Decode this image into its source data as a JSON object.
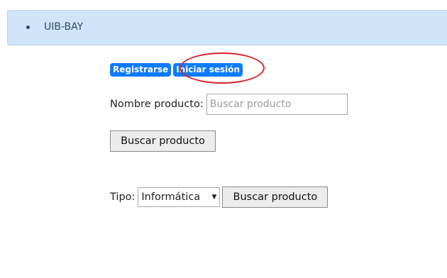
{
  "nav": {
    "brand": "UIB-BAY"
  },
  "auth": {
    "register_label": "Registrarse",
    "login_label": "Iniciar sesión"
  },
  "search": {
    "name_label": "Nombre producto:",
    "name_placeholder": "Buscar producto",
    "button_label": "Buscar producto"
  },
  "type_filter": {
    "label": "Tipo:",
    "selected": "Informática",
    "button_label": "Buscar producto"
  },
  "colors": {
    "nav_bg": "#d0e5fa",
    "badge_bg": "#0b7bff",
    "highlight": "#d9232a"
  },
  "icons": {
    "select_arrow": "triangle-down-icon"
  }
}
